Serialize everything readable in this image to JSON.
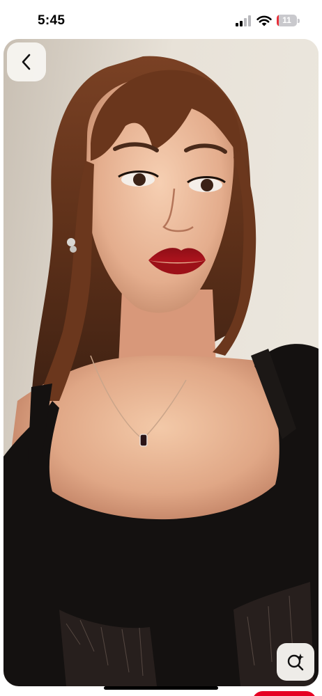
{
  "status_bar": {
    "time": "5:45",
    "battery_level": "11",
    "battery_fraction": 0.11,
    "battery_color": "#e8303a",
    "icons": [
      "signal-icon",
      "wifi-icon",
      "battery-icon"
    ]
  },
  "pin": {
    "back_icon": "chevron-left-icon",
    "visual_search_icon": "visual-search-icon"
  },
  "colors": {
    "save_button": "#e60023",
    "control_background": "#f7f5f0"
  }
}
